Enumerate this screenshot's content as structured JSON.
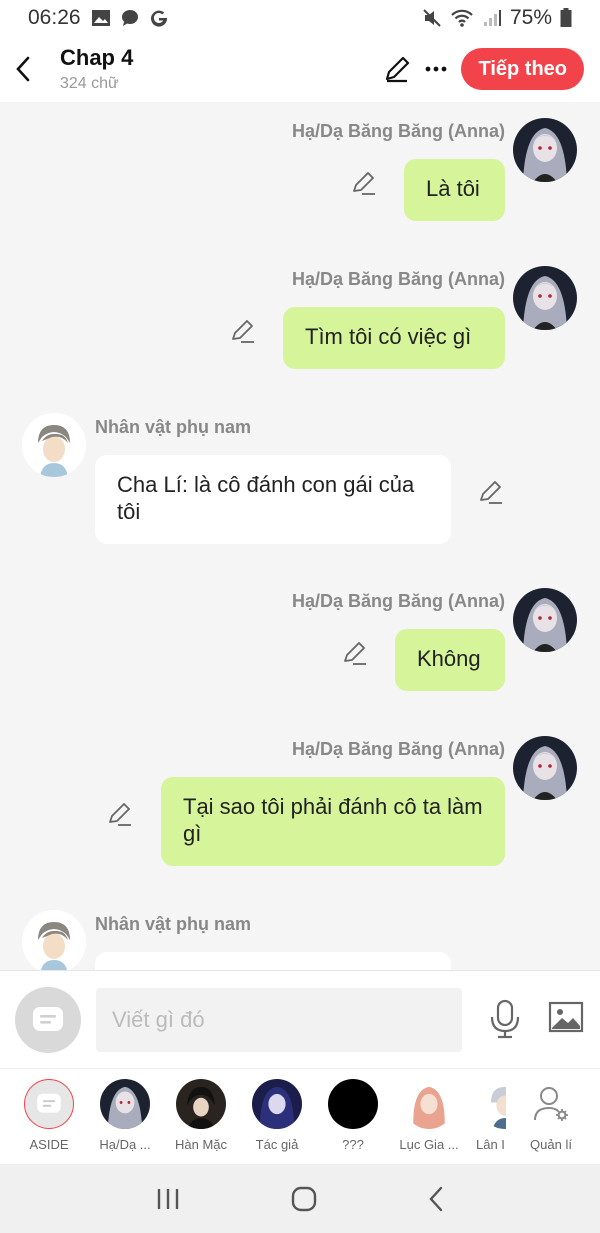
{
  "status_bar": {
    "time": "06:26",
    "battery": "75%"
  },
  "header": {
    "title": "Chap 4",
    "word_count": "324 chữ",
    "next_label": "Tiếp theo"
  },
  "messages": [
    {
      "side": "right",
      "name": "Hạ/Dạ Băng Băng (Anna)",
      "text": "Là tôi"
    },
    {
      "side": "right",
      "name": "Hạ/Dạ Băng Băng (Anna)",
      "text": "Tìm tôi có việc gì"
    },
    {
      "side": "left",
      "name": "Nhân vật phụ nam",
      "text": "Cha Lí: là cô đánh con gái của tôi"
    },
    {
      "side": "right",
      "name": "Hạ/Dạ Băng Băng (Anna)",
      "text": "Không"
    },
    {
      "side": "right",
      "name": "Hạ/Dạ Băng Băng (Anna)",
      "text": "Tại sao tôi phải đánh cô ta làm gì"
    },
    {
      "side": "left",
      "name": "Nhân vật phụ nam",
      "text": ""
    }
  ],
  "composer": {
    "placeholder": "Viết gì đó"
  },
  "characters": [
    {
      "label": "ASIDE"
    },
    {
      "label": "Hạ/Dạ ..."
    },
    {
      "label": "Hàn Mặc"
    },
    {
      "label": "Tác giả"
    },
    {
      "label": "???"
    },
    {
      "label": "Lục Gia ..."
    },
    {
      "label": "Lân I"
    },
    {
      "label": "Quản lí"
    }
  ],
  "colors": {
    "accent": "#f2424a",
    "bubble_self": "#d6f49a",
    "bubble_other": "#ffffff"
  }
}
